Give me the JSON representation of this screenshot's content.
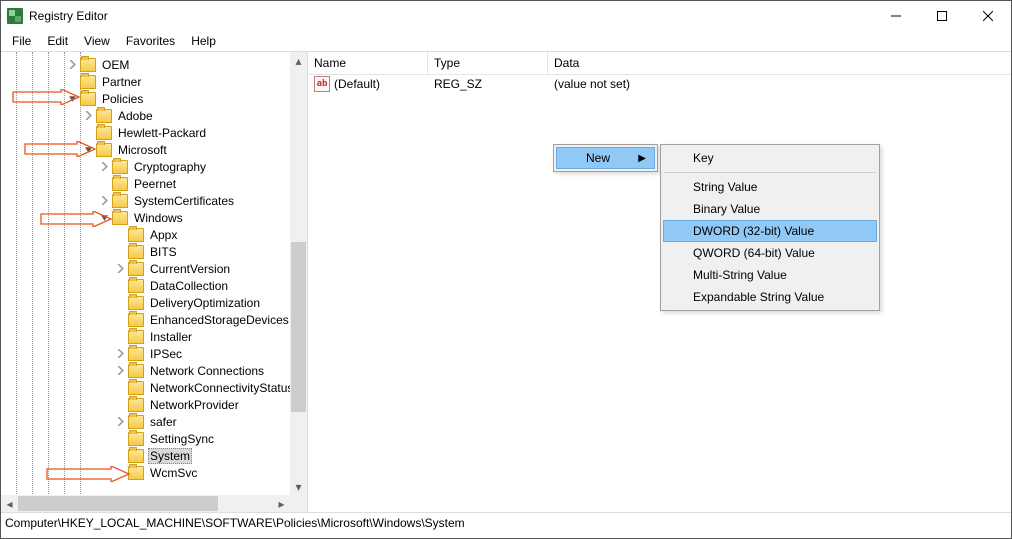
{
  "window": {
    "title": "Registry Editor",
    "min_label": "minimize",
    "max_label": "maximize",
    "close_label": "close"
  },
  "menu": {
    "file": "File",
    "edit": "Edit",
    "view": "View",
    "favorites": "Favorites",
    "help": "Help"
  },
  "tree": {
    "oem": "OEM",
    "partner": "Partner",
    "policies": "Policies",
    "adobe": "Adobe",
    "hp": "Hewlett-Packard",
    "microsoft": "Microsoft",
    "cryptography": "Cryptography",
    "peernet": "Peernet",
    "syscert": "SystemCertificates",
    "windows": "Windows",
    "appx": "Appx",
    "bits": "BITS",
    "currentversion": "CurrentVersion",
    "datacollection": "DataCollection",
    "deliveryopt": "DeliveryOptimization",
    "enhancedstorage": "EnhancedStorageDevices",
    "installer": "Installer",
    "ipsec": "IPSec",
    "netconn": "Network Connections",
    "netconnstat": "NetworkConnectivityStatus",
    "netprovider": "NetworkProvider",
    "safer": "safer",
    "settingsync": "SettingSync",
    "system": "System",
    "wcmsvc": "WcmSvc"
  },
  "list_header": {
    "name": "Name",
    "type": "Type",
    "data": "Data"
  },
  "list_rows": {
    "default_name": "(Default)",
    "default_type": "REG_SZ",
    "default_data": "(value not set)"
  },
  "context_menu": {
    "new": "New",
    "key": "Key",
    "string": "String Value",
    "binary": "Binary Value",
    "dword": "DWORD (32-bit) Value",
    "qword": "QWORD (64-bit) Value",
    "multistring": "Multi-String Value",
    "expandable": "Expandable String Value"
  },
  "statusbar": {
    "path": "Computer\\HKEY_LOCAL_MACHINE\\SOFTWARE\\Policies\\Microsoft\\Windows\\System"
  }
}
